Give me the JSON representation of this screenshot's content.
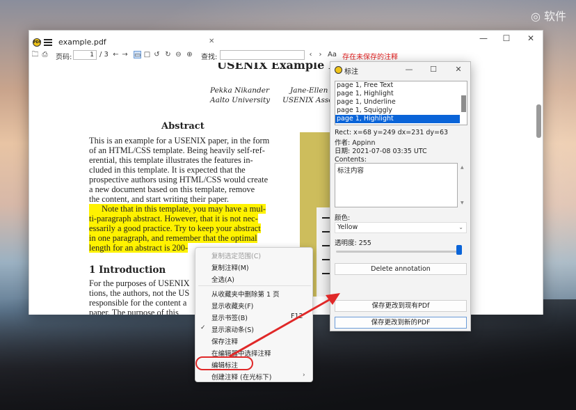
{
  "desktop": {
    "watermark": "软件"
  },
  "main_window": {
    "tab_title": "example.pdf",
    "toolbar": {
      "page_label": "页码:",
      "page_value": "1",
      "page_total": "/ 3",
      "search_label": "查找:",
      "search_placeholder": "",
      "match_case_label": "Aa",
      "unsaved_notice": "存在未保存的注释"
    },
    "document": {
      "title": "USENIX Example Pap",
      "authors": [
        {
          "name": "Pekka Nikander",
          "affiliation": "Aalto University"
        },
        {
          "name": "Jane-Ellen",
          "affiliation": "USENIX Asso"
        }
      ],
      "abstract_heading": "Abstract",
      "abstract_lines": [
        "This is an example for a USENIX paper, in the form",
        "of an HTML/CSS template. Being heavily self-ref-",
        "erential, this template illustrates the features in-",
        "cluded in this template. It is expected that the",
        "prospective authors using HTML/CSS would create",
        "a new document based on this template, remove",
        "the content, and start writing their paper."
      ],
      "highlighted_lines": [
        "Note that in this template, you may have a mul-",
        "ti-paragraph abstract. However, that it is not nec-",
        "essarily a good practice. Try to keep your abstract",
        "in one paragraph, and remember that the optimal",
        "length for an abstract is 200-"
      ],
      "intro_heading": "1 Introduction",
      "intro_lines": [
        "For the purposes of USENIX",
        "tions, the authors, not the US",
        "responsible for the content a",
        "paper. The purpose of this"
      ]
    }
  },
  "annotation_window": {
    "title": "标注",
    "list_items": [
      "page 1, Free Text",
      "page 1, Highlight",
      "page 1, Underline",
      "page 1, Squiggly",
      "page 1, Highlight"
    ],
    "selected_index": 4,
    "rect": "Rect: x=68 y=249 dx=231 dy=63",
    "author": "作者: Appinn",
    "date": "日期: 2021-07-08 03:35 UTC",
    "contents_label": "Contents:",
    "contents_value": "标注内容",
    "color_label": "颜色:",
    "color_value": "Yellow",
    "opacity_label": "透明度: 255",
    "opacity_fraction": 1.0,
    "delete_button": "Delete annotation",
    "save_existing_button": "保存更改到现有PDf",
    "save_new_button": "保存更改到新的PDF"
  },
  "context_menu": {
    "items": [
      {
        "label": "复制选定范围(C)",
        "disabled": true
      },
      {
        "label": "复制注释(M)"
      },
      {
        "label": "全选(A)"
      },
      {
        "label": "从收藏夹中删除第 1 页"
      },
      {
        "label": "显示收藏夹(F)"
      },
      {
        "label": "显示书签(B)",
        "shortcut": "F12"
      },
      {
        "label": "显示滚动条(S)",
        "checked": true
      },
      {
        "label": "保存注释"
      },
      {
        "label": "在编辑器中选择注释"
      },
      {
        "label": "编辑标注"
      },
      {
        "label": "创建注释 (在光标下)",
        "submenu": true
      }
    ]
  },
  "colors": {
    "highlight": "#fff200",
    "accent_blue": "#0a64d8",
    "alert_red": "#e02828",
    "figure_olive": "#cdbd5c"
  }
}
